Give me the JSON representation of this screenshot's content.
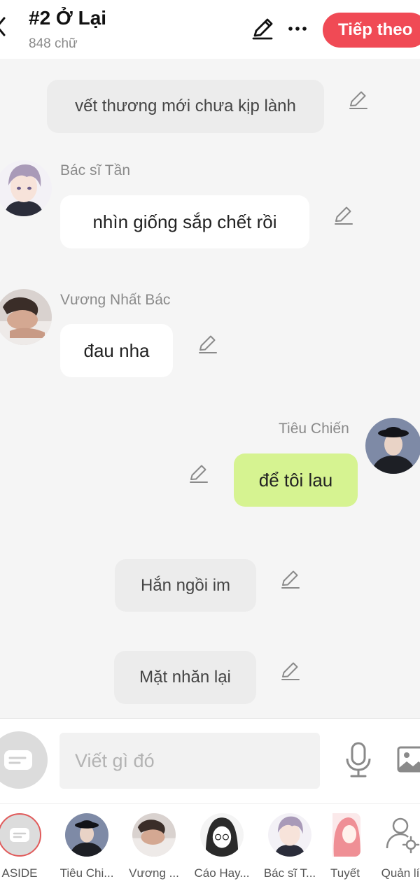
{
  "header": {
    "title": "#2 Ở Lại",
    "word_count": "848 chữ",
    "next_label": "Tiếp theo",
    "accent": "#f04a55"
  },
  "messages": {
    "m1": {
      "text": "vết thương mới chưa kịp lành"
    },
    "m2": {
      "sender": "Bác sĩ Tần",
      "text": "nhìn giống sắp chết rồi"
    },
    "m3": {
      "sender": "Vương Nhất Bác",
      "text": "đau nha"
    },
    "m4": {
      "sender": "Tiêu Chiến",
      "text": "để tôi lau"
    },
    "m5": {
      "text": "Hắn ngồi im"
    },
    "m6": {
      "text": "Mặt nhăn lại"
    }
  },
  "input": {
    "placeholder": "Viết gì đó",
    "value": ""
  },
  "icons": {
    "header": [
      "chevron-left-icon",
      "pencil-icon",
      "more-icon"
    ],
    "message_edit": "pencil-icon",
    "input": [
      "aside-icon",
      "microphone-icon",
      "image-icon"
    ]
  },
  "characters": [
    {
      "label": "ASIDE"
    },
    {
      "label": "Tiêu Chi..."
    },
    {
      "label": "Vương ..."
    },
    {
      "label": "Cáo Hay..."
    },
    {
      "label": "Bác sĩ T..."
    },
    {
      "label": "Tuyết"
    },
    {
      "label": "Quản lí"
    }
  ],
  "colors": {
    "outgoing_bubble": "#d6f391",
    "incoming_bubble": "#ffffff",
    "narration_bubble": "#ececec",
    "background": "#f5f5f5"
  }
}
